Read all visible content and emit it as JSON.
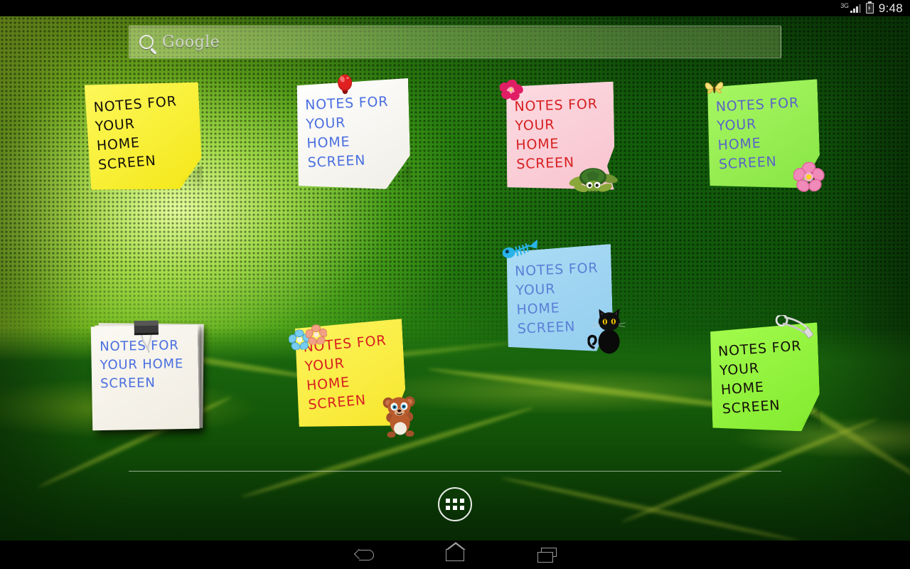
{
  "status_bar": {
    "network_label": "3G",
    "clock": "9:48",
    "icons": [
      "signal-bars-icon",
      "battery-charging-icon"
    ]
  },
  "search_widget": {
    "brand_label": "Google",
    "icon": "search-icon",
    "placeholder": "Google"
  },
  "hotseat": {
    "app_drawer_label": "Apps",
    "icon": "apps-grid-icon"
  },
  "nav_bar": {
    "back_label": "Back",
    "home_label": "Home",
    "recents_label": "Recent apps"
  },
  "notes": [
    {
      "id": "note-yellow-plain",
      "text": "Notes for\nyour\nhome\nscreen",
      "paper_color": "#fbf43c",
      "text_color": "#14100a",
      "decorations": []
    },
    {
      "id": "note-white-pin",
      "text": "Notes for\nyour\nhome\nscreen",
      "paper_color": "#fbfbf6",
      "text_color": "#4a6fe0",
      "decorations": [
        "red-pushpin-icon"
      ]
    },
    {
      "id": "note-pink-turtle",
      "text": "Notes for\nyour\nhome\nscreen",
      "paper_color": "#fbcfd8",
      "text_color": "#d71f20",
      "decorations": [
        "hibiscus-flower-icon",
        "turtle-icon"
      ]
    },
    {
      "id": "note-green-butterfly",
      "text": "Notes for\nyour\nhome\nscreen",
      "paper_color": "#95ef52",
      "text_color": "#5a63c8",
      "decorations": [
        "butterfly-icon",
        "pink-flower-icon"
      ]
    },
    {
      "id": "note-blue-cat",
      "text": "Notes for\nyour\nhome\nscreen",
      "paper_color": "#9ed3f0",
      "text_color": "#5a7fd6",
      "decorations": [
        "fish-bone-icon",
        "black-cat-icon"
      ]
    },
    {
      "id": "note-white-clip",
      "text": "Notes for\nyour home\nscreen",
      "paper_color": "#f7f4ec",
      "text_color": "#4a6fe0",
      "decorations": [
        "binder-clip-icon",
        "paper-stack"
      ]
    },
    {
      "id": "note-yellow-bear",
      "text": "Notes for\nyour\nhome\nscreen",
      "paper_color": "#fbeb43",
      "text_color": "#d71f20",
      "decorations": [
        "blue-flower-icon",
        "pink-flower-icon",
        "teddy-bear-icon"
      ]
    },
    {
      "id": "note-green-pin",
      "text": "Notes for\nyour\nhome\nscreen",
      "paper_color": "#8cf03c",
      "text_color": "#141008",
      "decorations": [
        "safety-pin-icon"
      ]
    }
  ]
}
